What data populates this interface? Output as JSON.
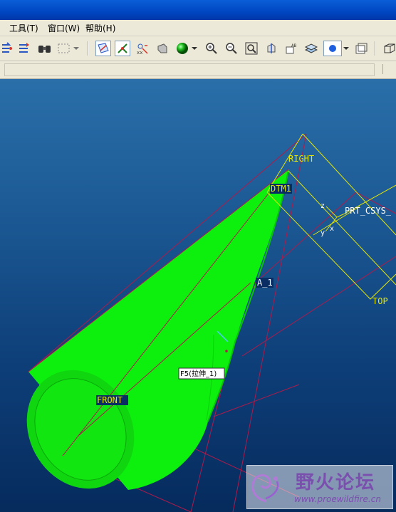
{
  "menubar": {
    "items": [
      {
        "label": "工具(T)"
      },
      {
        "label": "窗口(W)"
      },
      {
        "label": "帮助(H)"
      }
    ]
  },
  "toolbar": {
    "icons": [
      "regenerate-icon",
      "regenerate-manager-icon",
      "find-icon",
      "select-box-icon",
      "datum-planes-icon",
      "datum-axes-icon",
      "datum-points-icon",
      "shading-icon",
      "appearance-ball-icon",
      "zoom-in-icon",
      "zoom-out-icon",
      "refit-icon",
      "reorient-icon",
      "saved-views-icon",
      "layers-icon",
      "model-display-icon",
      "spin-center-icon"
    ]
  },
  "viewport": {
    "labels": {
      "right": "RIGHT",
      "dtm1": "DTM1",
      "csys": "PRT_CSYS_",
      "a1": "A_1",
      "top": "TOP",
      "front": "FRONT",
      "feature_tip": "F5(拉伸_1)",
      "z_axis": "z",
      "y_axis": "y",
      "x_axis": "x"
    },
    "colors": {
      "model_fill": "#00ee00",
      "datum_plane": "#e6e600",
      "datum_edge": "#b01a4a"
    }
  },
  "watermark": {
    "title": "野火论坛",
    "url": "www.proewildfire.cn"
  }
}
